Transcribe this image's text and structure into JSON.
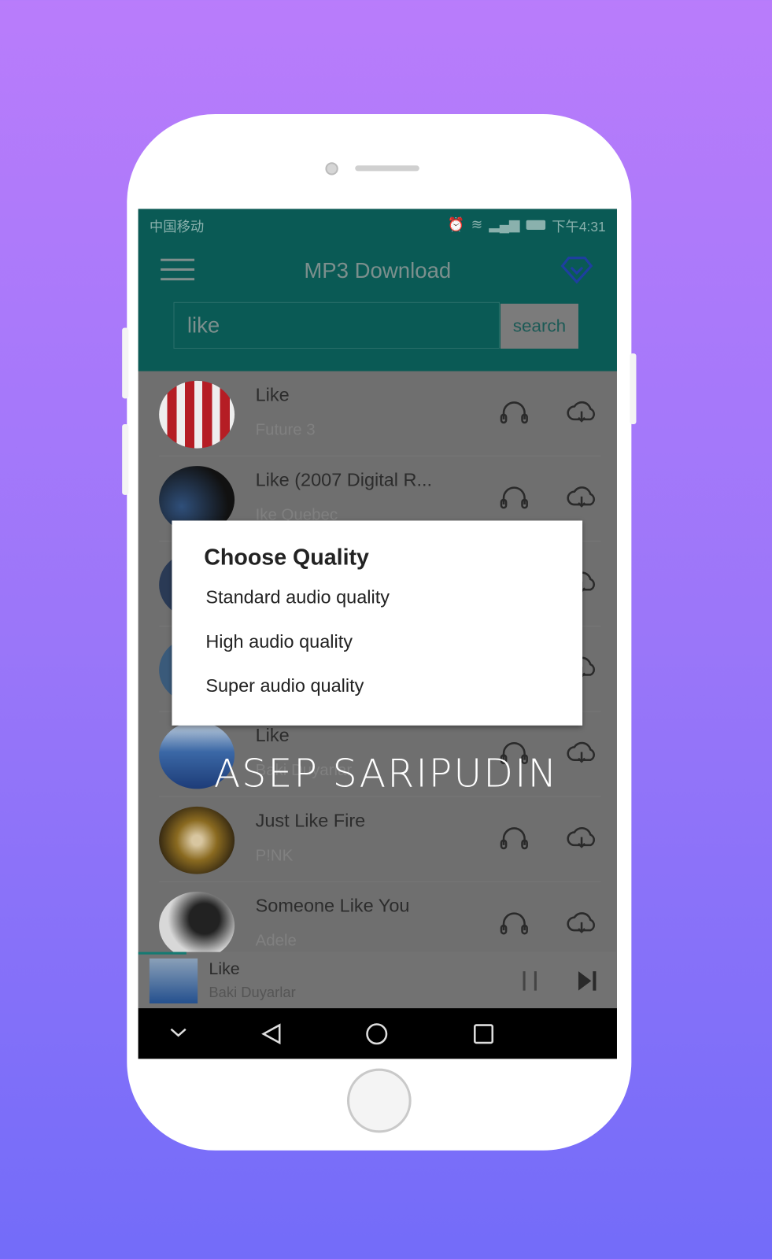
{
  "status_bar": {
    "carrier": "中国移动",
    "time": "下午4:31"
  },
  "header": {
    "title": "MP3 Download",
    "search_value": "like",
    "search_button": "search"
  },
  "songs": [
    {
      "title": "Like",
      "artist": "Future 3"
    },
    {
      "title": "Like (2007 Digital R...",
      "artist": "Ike Quebec"
    },
    {
      "title": "",
      "artist": ""
    },
    {
      "title": "",
      "artist": ""
    },
    {
      "title": "Like",
      "artist": "Baki Duyarlar"
    },
    {
      "title": "Just Like Fire",
      "artist": "P!NK"
    },
    {
      "title": "Someone Like You",
      "artist": "Adele"
    }
  ],
  "now_playing": {
    "title": "Like",
    "artist": "Baki Duyarlar",
    "progress_percent": 10
  },
  "dialog": {
    "title": "Choose Quality",
    "options": [
      "Standard audio quality",
      "High audio quality",
      "Super audio quality"
    ]
  },
  "watermark": "ASEP SARIPUDIN",
  "colors": {
    "header": "#0a5a55",
    "accent": "#157a72",
    "vip_icon": "#1e3fa0"
  }
}
